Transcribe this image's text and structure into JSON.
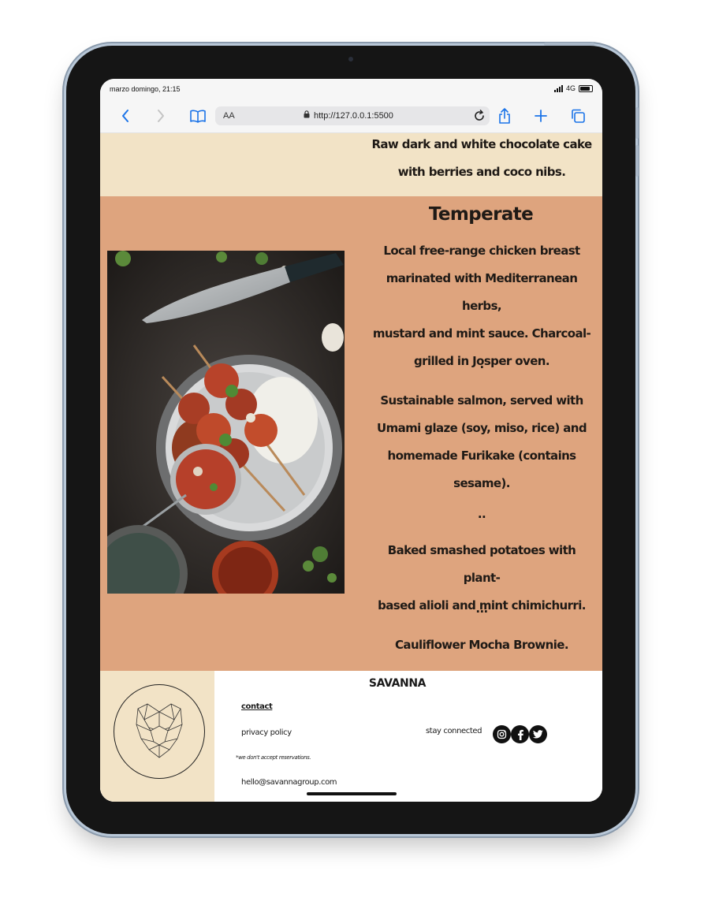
{
  "status_bar": {
    "time": "marzo domingo, 21:15",
    "network": "4G"
  },
  "browser": {
    "text_size_label": "AA",
    "url": "http://127.0.0.1:5500",
    "icons": [
      "back-icon",
      "forward-icon",
      "bookmarks-icon",
      "lock-icon",
      "reload-icon",
      "share-icon",
      "new-tab-icon",
      "tabs-icon"
    ]
  },
  "menu": {
    "previous_dessert": [
      "Raw dark and white chocolate cake",
      "with berries and coco nibs."
    ],
    "section_title": "Temperate",
    "dish_1": [
      "Local free-range chicken breast",
      "marinated with Mediterranean herbs,",
      "mustard and mint sauce. Charcoal-",
      "grilled in Josper oven."
    ],
    "sep_1": ".",
    "dish_2": [
      "Sustainable salmon, served with",
      "Umami glaze (soy, miso, rice) and",
      "homemade Furikake (contains",
      "sesame)."
    ],
    "sep_2": "..",
    "dish_3": [
      "Baked smashed potatoes with plant-",
      "based alioli and mint chimichurri."
    ],
    "sep_3": "...",
    "dish_4": "Cauliflower Mocha Brownie."
  },
  "footer": {
    "brand": "SAVANNA",
    "contact_link": "contact",
    "privacy_link": "privacy policy",
    "reservations_note": "*we don't accept reservations.",
    "email": "hello@savannagroup.com",
    "stay_connected": "stay connected",
    "social_icons": [
      "instagram-icon",
      "facebook-icon",
      "twitter-icon"
    ]
  },
  "colors": {
    "beige": "#f2e3c6",
    "terracotta": "#dea47e",
    "text_dark": "#1f1a16",
    "browser_blue": "#1a73e8"
  }
}
